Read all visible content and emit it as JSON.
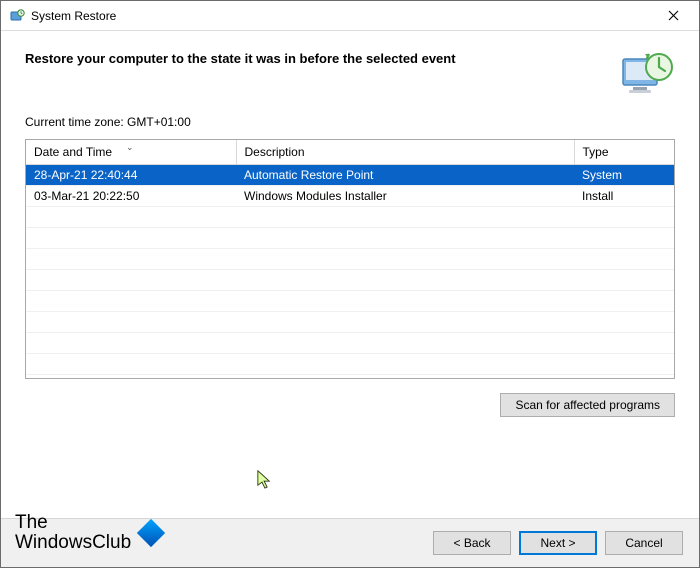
{
  "window": {
    "title": "System Restore"
  },
  "header": {
    "heading": "Restore your computer to the state it was in before the selected event"
  },
  "timezone_label": "Current time zone: GMT+01:00",
  "table": {
    "columns": {
      "c0": "Date and Time",
      "c1": "Description",
      "c2": "Type"
    },
    "rows": [
      {
        "date": "28-Apr-21 22:40:44",
        "desc": "Automatic Restore Point",
        "type": "System",
        "selected": true
      },
      {
        "date": "03-Mar-21 20:22:50",
        "desc": "Windows Modules Installer",
        "type": "Install",
        "selected": false
      }
    ]
  },
  "buttons": {
    "scan": "Scan for affected programs",
    "back": "< Back",
    "next": "Next >",
    "cancel": "Cancel"
  },
  "watermark": {
    "line1": "The",
    "line2": "WindowsClub"
  }
}
